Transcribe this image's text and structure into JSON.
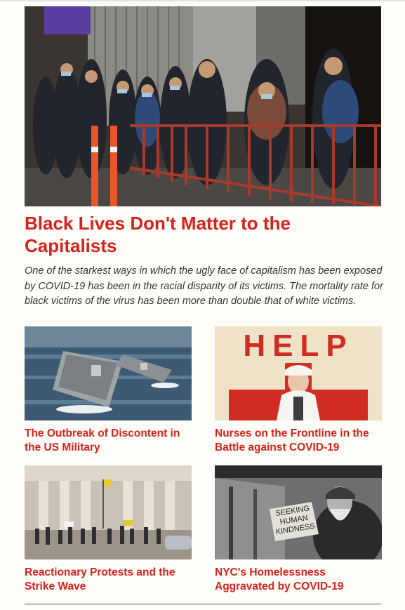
{
  "lead": {
    "image_alt": "People wearing masks waiting in line along a red metal barrier",
    "title": "Black Lives Don't Matter to the Capitalists",
    "dek": "One of the starkest ways in which the ugly face of capitalism has been exposed by COVID-19 has been in the racial disparity of its victims. The mortality rate for black victims of the virus has been more than double that of white victims."
  },
  "cards": [
    {
      "title": "The Outbreak of Discontent in the US Military"
    },
    {
      "title": "Nurses on the Frontline in the Battle against COVID-19",
      "poster_text": "HELP"
    },
    {
      "title": "Reactionary Protests and the Strike Wave"
    },
    {
      "title": "NYC's Homelessness Aggravated by COVID-19",
      "sign_text": [
        "SEEKING",
        "HUMAN",
        "KINDNESS"
      ]
    }
  ],
  "colors": {
    "accent": "#d6221e",
    "background": "#fffdf7",
    "text": "#333333"
  }
}
